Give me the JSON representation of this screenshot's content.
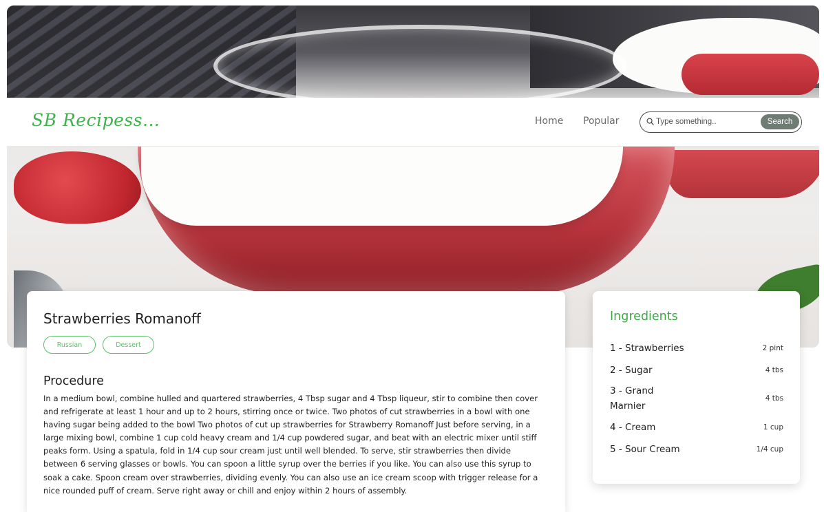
{
  "nav": {
    "logo": "SB Recipess...",
    "links": [
      "Home",
      "Popular"
    ],
    "search_placeholder": "Type something..",
    "search_button": "Search"
  },
  "recipe": {
    "title": "Strawberries Romanoff",
    "tags": [
      "Russian",
      "Dessert"
    ],
    "procedure_heading": "Procedure",
    "procedure_text": "In a medium bowl, combine hulled and quartered strawberries, 4 Tbsp sugar and 4 Tbsp liqueur, stir to combine then cover and refrigerate at least 1 hour and up to 2 hours, stirring once or twice. Two photos of cut strawberries in a bowl with one having sugar being added to the bowl Two photos of cut up strawberries for Strawberry Romanoff Just before serving, in a large mixing bowl, combine 1 cup cold heavy cream and 1/4 cup powdered sugar, and beat with an electric mixer until stiff peaks form. Using a spatula, fold in 1/4 cup sour cream just until well blended. To serve, stir strawberries then divide between 6 serving glasses or bowls. You can spoon a little syrup over the berries if you like. You can also use this syrup to soak a cake. Spoon cream over strawberries, dividing evenly. You can also use an ice cream scoop with trigger release for a nice rounded puff of cream. Serve right away or chill and enjoy within 2 hours of assembly."
  },
  "ingredients": {
    "title": "Ingredients",
    "items": [
      {
        "name": "1 - Strawberries",
        "qty": "2 pint"
      },
      {
        "name": "2 - Sugar",
        "qty": "4 tbs"
      },
      {
        "name": "3 - Grand Marnier",
        "qty": "4 tbs"
      },
      {
        "name": "4 - Cream",
        "qty": "1 cup"
      },
      {
        "name": "5 - Sour Cream",
        "qty": "1/4 cup"
      }
    ]
  },
  "colors": {
    "brand_green": "#3cb44a",
    "search_button_bg": "#6e7c73"
  },
  "icons": {
    "search": "search-icon"
  }
}
